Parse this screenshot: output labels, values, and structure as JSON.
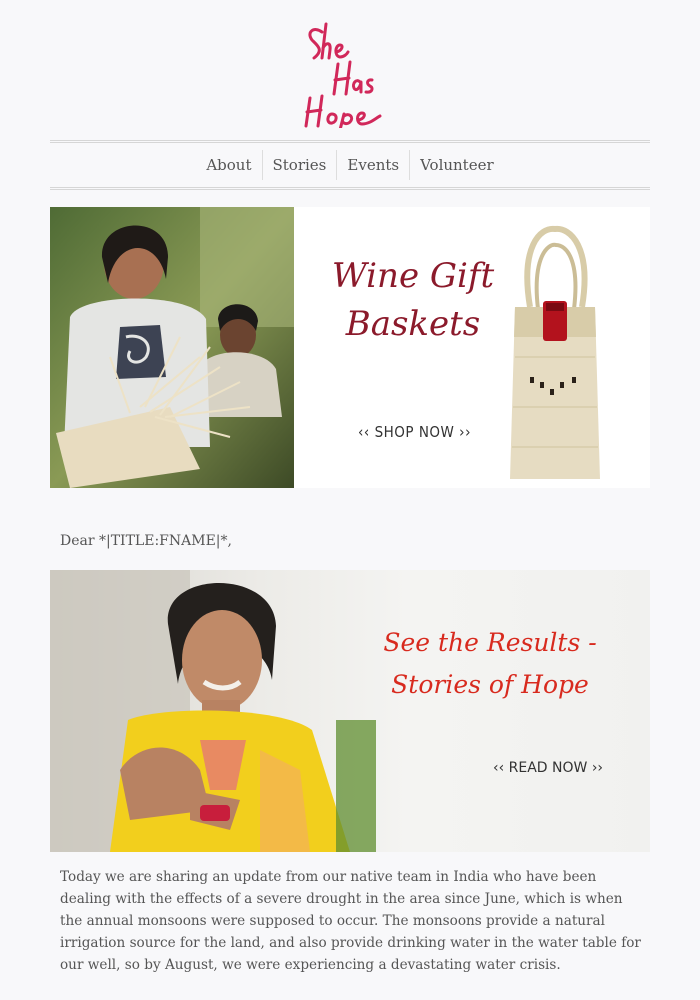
{
  "logo": {
    "text": "She Has Hope"
  },
  "nav": {
    "items": [
      "About",
      "Stories",
      "Events",
      "Volunteer"
    ]
  },
  "banner": {
    "title": "Wine Gift Baskets",
    "cta": "‹‹ SHOP NOW ››"
  },
  "greeting": "Dear *|TITLE:FNAME|*,",
  "hero": {
    "title": "See the Results - Stories of Hope",
    "cta": "‹‹ READ NOW ››"
  },
  "body_text": "Today we are sharing an update from our native team in India who have been dealing with the effects of a severe drought in the area since June, which is when the annual monsoons were supposed to occur. The monsoons provide a natural irrigation source for the land, and also provide drinking water in the water table for our well, so by August, we were experiencing a devastating water crisis.",
  "colors": {
    "brand": "#d1285a",
    "wine": "#8b1a2b",
    "hero_red": "#d82a1e"
  }
}
